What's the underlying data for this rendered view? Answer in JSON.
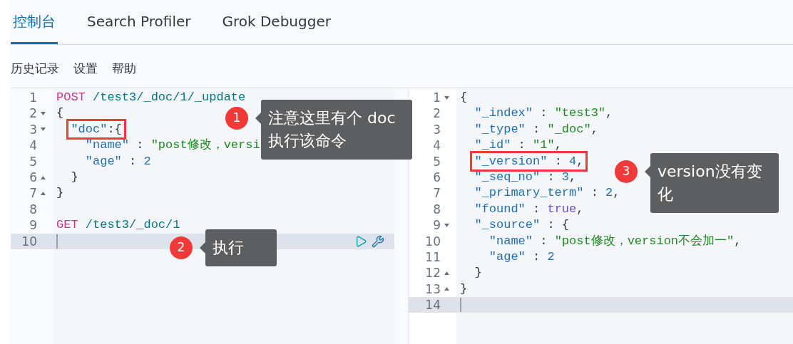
{
  "tabs": [
    {
      "label": "控制台",
      "selected": true
    },
    {
      "label": "Search Profiler",
      "selected": false
    },
    {
      "label": "Grok Debugger",
      "selected": false
    }
  ],
  "menu": [
    "历史记录",
    "设置",
    "帮助"
  ],
  "request_editor": {
    "lines": [
      {
        "number": "1",
        "kind": "plain",
        "tokens": [
          {
            "kind": "keyword",
            "text": "POST"
          },
          {
            "kind": "url",
            "text": " /test3/_doc/1/_update"
          }
        ]
      },
      {
        "number": "2",
        "kind": "fold-start",
        "tokens": [
          {
            "kind": "punct",
            "text": "{"
          }
        ]
      },
      {
        "number": "3",
        "kind": "fold-start",
        "framed": true,
        "tokens": [
          {
            "kind": "key",
            "text": "  \"doc\""
          },
          {
            "kind": "punct",
            "text": ":{"
          }
        ]
      },
      {
        "number": "4",
        "kind": "plain",
        "tokens": [
          {
            "kind": "key",
            "text": "    \"name\""
          },
          {
            "kind": "punct",
            "text": " : "
          },
          {
            "kind": "string",
            "text": "\"post修改，versi"
          }
        ]
      },
      {
        "number": "5",
        "kind": "plain",
        "tokens": [
          {
            "kind": "key",
            "text": "    \"age\""
          },
          {
            "kind": "punct",
            "text": " : "
          },
          {
            "kind": "number",
            "text": "2"
          }
        ]
      },
      {
        "number": "6",
        "kind": "fold-end",
        "tokens": [
          {
            "kind": "punct",
            "text": "  }"
          }
        ]
      },
      {
        "number": "7",
        "kind": "fold-end",
        "tokens": [
          {
            "kind": "punct",
            "text": "}"
          }
        ]
      },
      {
        "number": "8",
        "kind": "plain"
      },
      {
        "number": "9",
        "kind": "plain",
        "tokens": [
          {
            "kind": "keyword",
            "text": "GET"
          },
          {
            "kind": "url",
            "text": " /test3/_doc/1"
          }
        ]
      },
      {
        "number": "10",
        "kind": "plain",
        "active": true
      }
    ]
  },
  "response_editor": {
    "lines": [
      {
        "number": "1",
        "kind": "fold-start",
        "tokens": [
          {
            "kind": "punct",
            "text": "{"
          }
        ]
      },
      {
        "number": "2",
        "kind": "plain",
        "tokens": [
          {
            "kind": "key",
            "text": "  \"_index\""
          },
          {
            "kind": "punct",
            "text": " : "
          },
          {
            "kind": "string",
            "text": "\"test3\""
          },
          {
            "kind": "punct",
            "text": ","
          }
        ]
      },
      {
        "number": "3",
        "kind": "plain",
        "tokens": [
          {
            "kind": "key",
            "text": "  \"_type\""
          },
          {
            "kind": "punct",
            "text": " : "
          },
          {
            "kind": "string",
            "text": "\"_doc\""
          },
          {
            "kind": "punct",
            "text": ","
          }
        ]
      },
      {
        "number": "4",
        "kind": "plain",
        "tokens": [
          {
            "kind": "key",
            "text": "  \"_id\""
          },
          {
            "kind": "punct",
            "text": " : "
          },
          {
            "kind": "string",
            "text": "\"1\""
          },
          {
            "kind": "punct",
            "text": ","
          }
        ]
      },
      {
        "number": "5",
        "kind": "plain",
        "framed": true,
        "tokens": [
          {
            "kind": "key",
            "text": "  \"_version\""
          },
          {
            "kind": "punct",
            "text": " : "
          },
          {
            "kind": "number",
            "text": "4"
          },
          {
            "kind": "punct",
            "text": ","
          }
        ]
      },
      {
        "number": "6",
        "kind": "plain",
        "tokens": [
          {
            "kind": "key",
            "text": "  \"_seq_no\""
          },
          {
            "kind": "punct",
            "text": " : "
          },
          {
            "kind": "number",
            "text": "3"
          },
          {
            "kind": "punct",
            "text": ","
          }
        ]
      },
      {
        "number": "7",
        "kind": "plain",
        "tokens": [
          {
            "kind": "key",
            "text": "  \"_primary_term\""
          },
          {
            "kind": "punct",
            "text": " : "
          },
          {
            "kind": "number",
            "text": "2"
          },
          {
            "kind": "punct",
            "text": ","
          }
        ]
      },
      {
        "number": "8",
        "kind": "plain",
        "tokens": [
          {
            "kind": "key",
            "text": "  \"found\""
          },
          {
            "kind": "punct",
            "text": " : "
          },
          {
            "kind": "bool",
            "text": "true"
          },
          {
            "kind": "punct",
            "text": ","
          }
        ]
      },
      {
        "number": "9",
        "kind": "fold-start",
        "tokens": [
          {
            "kind": "key",
            "text": "  \"_source\""
          },
          {
            "kind": "punct",
            "text": " : {"
          }
        ]
      },
      {
        "number": "10",
        "kind": "plain",
        "tokens": [
          {
            "kind": "key",
            "text": "    \"name\""
          },
          {
            "kind": "punct",
            "text": " : "
          },
          {
            "kind": "string",
            "text": "\"post修改，version不会加一\""
          },
          {
            "kind": "punct",
            "text": ","
          }
        ]
      },
      {
        "number": "11",
        "kind": "plain",
        "tokens": [
          {
            "kind": "key",
            "text": "    \"age\""
          },
          {
            "kind": "punct",
            "text": " : "
          },
          {
            "kind": "number",
            "text": "2"
          }
        ]
      },
      {
        "number": "12",
        "kind": "fold-end",
        "tokens": [
          {
            "kind": "punct",
            "text": "  }"
          }
        ]
      },
      {
        "number": "13",
        "kind": "fold-end",
        "tokens": [
          {
            "kind": "punct",
            "text": "}"
          }
        ]
      },
      {
        "number": "14",
        "kind": "plain",
        "active": true
      }
    ]
  },
  "annotations": [
    {
      "number": "1",
      "text": "注意这里有个 doc 执行该命令"
    },
    {
      "number": "2",
      "text": "执行"
    },
    {
      "number": "3",
      "text": "version没有变化"
    }
  ]
}
